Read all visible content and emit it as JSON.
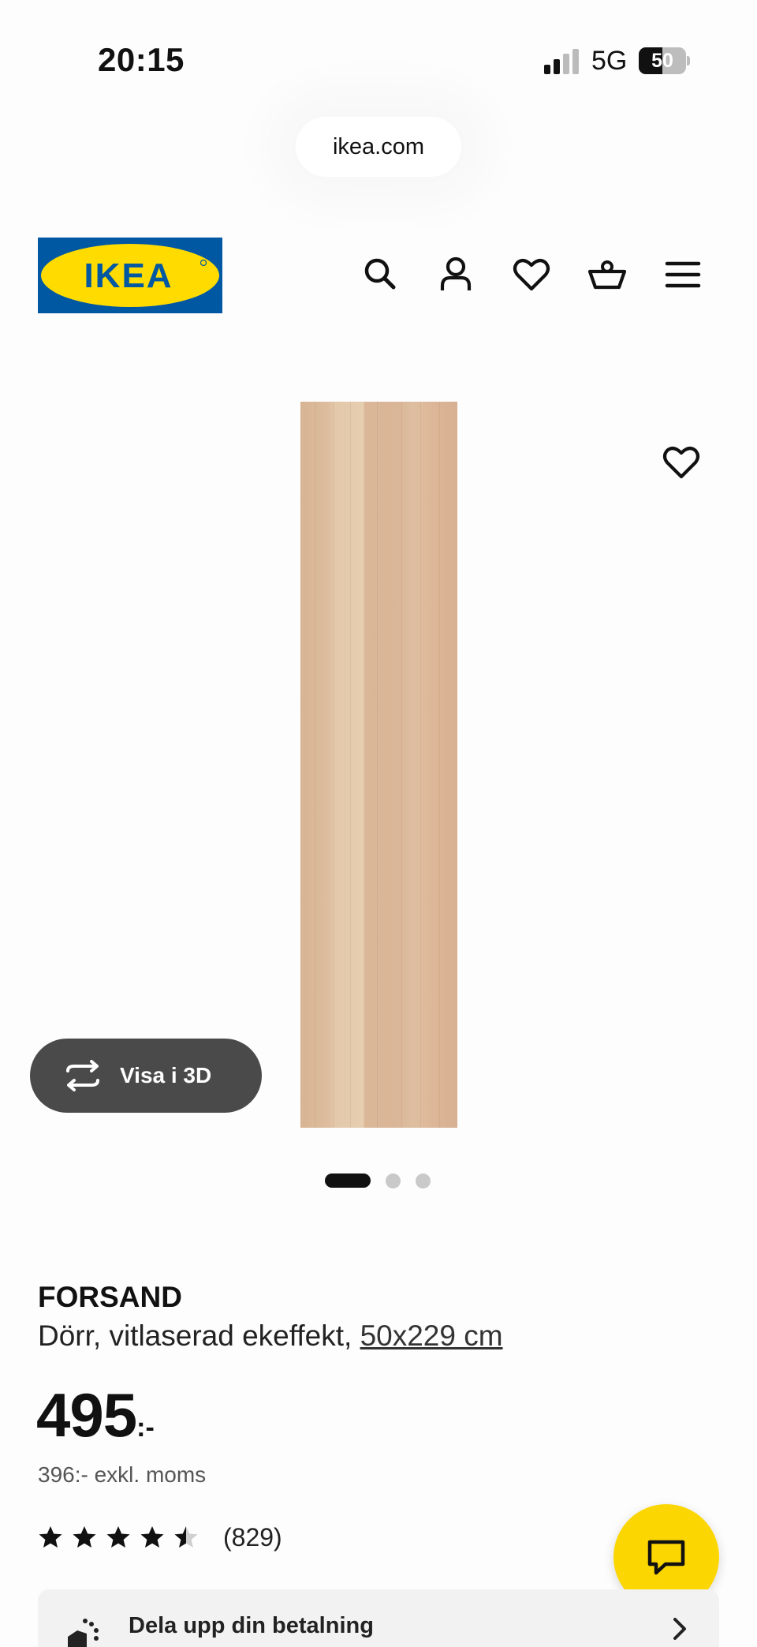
{
  "status_bar": {
    "time": "20:15",
    "network": "5G",
    "battery": "50",
    "battery_level": 0.5,
    "signal_icon": "cellular-signal-icon"
  },
  "browser": {
    "url": "ikea.com"
  },
  "header": {
    "logo_text": "IKEA",
    "brand_colors": {
      "blue": "#0058a3",
      "yellow": "#ffdb00"
    },
    "icons": [
      "search-icon",
      "account-icon",
      "heart-icon",
      "basket-icon",
      "menu-icon"
    ]
  },
  "gallery": {
    "view_3d_label": "Visa i 3D",
    "slides_total": 3,
    "active_slide": 1
  },
  "product": {
    "name": "FORSAND",
    "description": "Dörr, vitlaserad ekeffekt, ",
    "size": "50x229 cm",
    "price": "495",
    "price_suffix": ":-",
    "price_ex_vat": "396:- exkl. moms",
    "rating": 4.5,
    "rating_max": 5,
    "review_count": "(829)"
  },
  "payment": {
    "label": "Dela upp din betalning"
  },
  "colors": {
    "chat_button": "#fcd600",
    "view3d_button": "#4a4a4a"
  }
}
